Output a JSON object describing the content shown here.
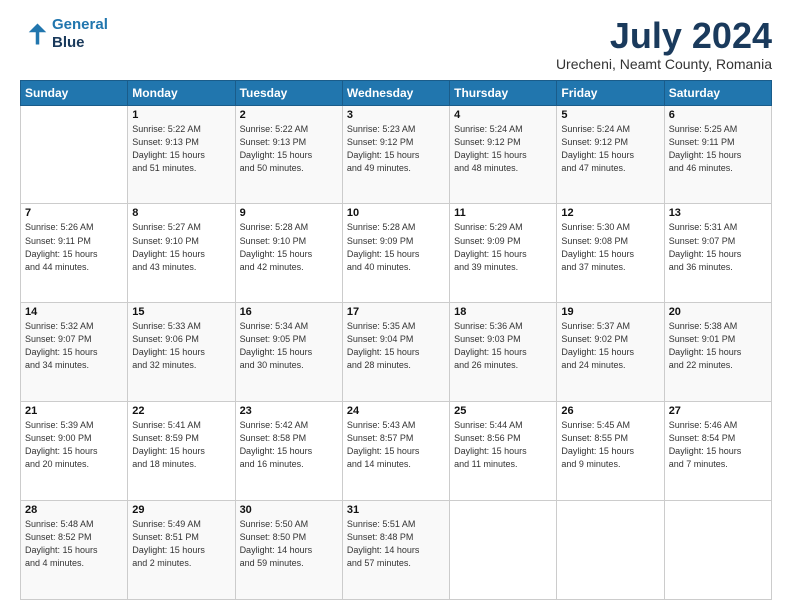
{
  "logo": {
    "line1": "General",
    "line2": "Blue"
  },
  "title": "July 2024",
  "subtitle": "Urecheni, Neamt County, Romania",
  "header": {
    "days": [
      "Sunday",
      "Monday",
      "Tuesday",
      "Wednesday",
      "Thursday",
      "Friday",
      "Saturday"
    ]
  },
  "weeks": [
    [
      {
        "day": "",
        "info": ""
      },
      {
        "day": "1",
        "info": "Sunrise: 5:22 AM\nSunset: 9:13 PM\nDaylight: 15 hours\nand 51 minutes."
      },
      {
        "day": "2",
        "info": "Sunrise: 5:22 AM\nSunset: 9:13 PM\nDaylight: 15 hours\nand 50 minutes."
      },
      {
        "day": "3",
        "info": "Sunrise: 5:23 AM\nSunset: 9:12 PM\nDaylight: 15 hours\nand 49 minutes."
      },
      {
        "day": "4",
        "info": "Sunrise: 5:24 AM\nSunset: 9:12 PM\nDaylight: 15 hours\nand 48 minutes."
      },
      {
        "day": "5",
        "info": "Sunrise: 5:24 AM\nSunset: 9:12 PM\nDaylight: 15 hours\nand 47 minutes."
      },
      {
        "day": "6",
        "info": "Sunrise: 5:25 AM\nSunset: 9:11 PM\nDaylight: 15 hours\nand 46 minutes."
      }
    ],
    [
      {
        "day": "7",
        "info": "Sunrise: 5:26 AM\nSunset: 9:11 PM\nDaylight: 15 hours\nand 44 minutes."
      },
      {
        "day": "8",
        "info": "Sunrise: 5:27 AM\nSunset: 9:10 PM\nDaylight: 15 hours\nand 43 minutes."
      },
      {
        "day": "9",
        "info": "Sunrise: 5:28 AM\nSunset: 9:10 PM\nDaylight: 15 hours\nand 42 minutes."
      },
      {
        "day": "10",
        "info": "Sunrise: 5:28 AM\nSunset: 9:09 PM\nDaylight: 15 hours\nand 40 minutes."
      },
      {
        "day": "11",
        "info": "Sunrise: 5:29 AM\nSunset: 9:09 PM\nDaylight: 15 hours\nand 39 minutes."
      },
      {
        "day": "12",
        "info": "Sunrise: 5:30 AM\nSunset: 9:08 PM\nDaylight: 15 hours\nand 37 minutes."
      },
      {
        "day": "13",
        "info": "Sunrise: 5:31 AM\nSunset: 9:07 PM\nDaylight: 15 hours\nand 36 minutes."
      }
    ],
    [
      {
        "day": "14",
        "info": "Sunrise: 5:32 AM\nSunset: 9:07 PM\nDaylight: 15 hours\nand 34 minutes."
      },
      {
        "day": "15",
        "info": "Sunrise: 5:33 AM\nSunset: 9:06 PM\nDaylight: 15 hours\nand 32 minutes."
      },
      {
        "day": "16",
        "info": "Sunrise: 5:34 AM\nSunset: 9:05 PM\nDaylight: 15 hours\nand 30 minutes."
      },
      {
        "day": "17",
        "info": "Sunrise: 5:35 AM\nSunset: 9:04 PM\nDaylight: 15 hours\nand 28 minutes."
      },
      {
        "day": "18",
        "info": "Sunrise: 5:36 AM\nSunset: 9:03 PM\nDaylight: 15 hours\nand 26 minutes."
      },
      {
        "day": "19",
        "info": "Sunrise: 5:37 AM\nSunset: 9:02 PM\nDaylight: 15 hours\nand 24 minutes."
      },
      {
        "day": "20",
        "info": "Sunrise: 5:38 AM\nSunset: 9:01 PM\nDaylight: 15 hours\nand 22 minutes."
      }
    ],
    [
      {
        "day": "21",
        "info": "Sunrise: 5:39 AM\nSunset: 9:00 PM\nDaylight: 15 hours\nand 20 minutes."
      },
      {
        "day": "22",
        "info": "Sunrise: 5:41 AM\nSunset: 8:59 PM\nDaylight: 15 hours\nand 18 minutes."
      },
      {
        "day": "23",
        "info": "Sunrise: 5:42 AM\nSunset: 8:58 PM\nDaylight: 15 hours\nand 16 minutes."
      },
      {
        "day": "24",
        "info": "Sunrise: 5:43 AM\nSunset: 8:57 PM\nDaylight: 15 hours\nand 14 minutes."
      },
      {
        "day": "25",
        "info": "Sunrise: 5:44 AM\nSunset: 8:56 PM\nDaylight: 15 hours\nand 11 minutes."
      },
      {
        "day": "26",
        "info": "Sunrise: 5:45 AM\nSunset: 8:55 PM\nDaylight: 15 hours\nand 9 minutes."
      },
      {
        "day": "27",
        "info": "Sunrise: 5:46 AM\nSunset: 8:54 PM\nDaylight: 15 hours\nand 7 minutes."
      }
    ],
    [
      {
        "day": "28",
        "info": "Sunrise: 5:48 AM\nSunset: 8:52 PM\nDaylight: 15 hours\nand 4 minutes."
      },
      {
        "day": "29",
        "info": "Sunrise: 5:49 AM\nSunset: 8:51 PM\nDaylight: 15 hours\nand 2 minutes."
      },
      {
        "day": "30",
        "info": "Sunrise: 5:50 AM\nSunset: 8:50 PM\nDaylight: 14 hours\nand 59 minutes."
      },
      {
        "day": "31",
        "info": "Sunrise: 5:51 AM\nSunset: 8:48 PM\nDaylight: 14 hours\nand 57 minutes."
      },
      {
        "day": "",
        "info": ""
      },
      {
        "day": "",
        "info": ""
      },
      {
        "day": "",
        "info": ""
      }
    ]
  ]
}
